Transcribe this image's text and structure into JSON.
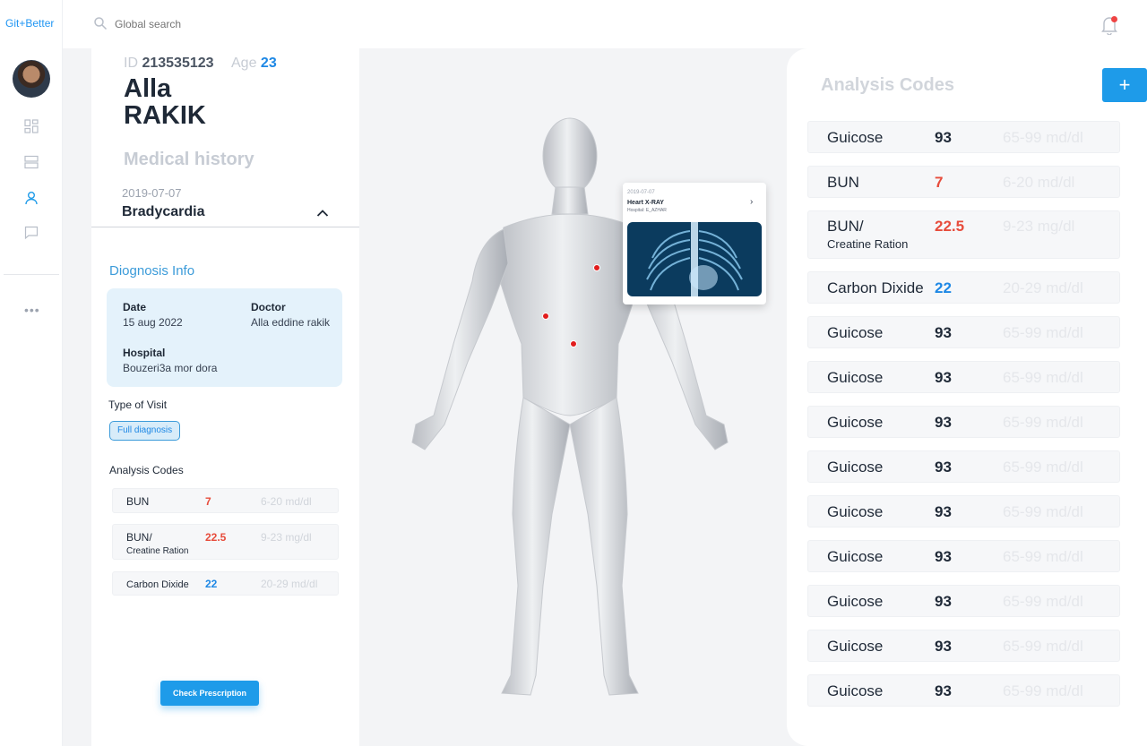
{
  "app": {
    "logo": "Git+Better"
  },
  "search": {
    "placeholder": "Global search"
  },
  "patient": {
    "id_label": "ID",
    "id": "213535123",
    "age_label": "Age",
    "age": "23",
    "first_name": "Alla",
    "last_name": "RAKIK"
  },
  "history": {
    "title": "Medical history",
    "date": "2019-07-07",
    "condition": "Bradycardia"
  },
  "diagnosis": {
    "title": "Diognosis Info",
    "date_label": "Date",
    "date": "15 aug 2022",
    "doctor_label": "Doctor",
    "doctor": "Alla eddine rakik",
    "hospital_label": "Hospital",
    "hospital": "Bouzeri3a mor dora",
    "visit_label": "Type of Visit",
    "visit_type": "Full diagnosis",
    "codes_title": "Analysis Codes",
    "codes": [
      {
        "name": "BUN",
        "sub": "",
        "value": "7",
        "range": "6-20 md/dl",
        "color": "#e74c3c"
      },
      {
        "name": "BUN/",
        "sub": "Creatine Ration",
        "value": "22.5",
        "range": "9-23 mg/dl",
        "color": "#e74c3c"
      },
      {
        "name": "Carbon Dixide",
        "sub": "",
        "value": "22",
        "range": "20-29 md/dl",
        "color": "#1e88e5"
      }
    ],
    "prescription_button": "Check Prescription"
  },
  "xray": {
    "date": "2019-07-07",
    "title": "Heart X-RAY",
    "hospital": "Hospital: E_AZHAR",
    "arrow": "›"
  },
  "analysis": {
    "title": "Analysis Codes",
    "add_label": "+",
    "rows": [
      {
        "name": "Guicose",
        "sub": "",
        "value": "93",
        "range": "65-99 md/dl",
        "color": "#1f2937"
      },
      {
        "name": "BUN",
        "sub": "",
        "value": "7",
        "range": "6-20 md/dl",
        "color": "#e74c3c"
      },
      {
        "name": "BUN/",
        "sub": "Creatine Ration",
        "value": "22.5",
        "range": "9-23 mg/dl",
        "color": "#e74c3c"
      },
      {
        "name": "Carbon Dixide",
        "sub": "",
        "value": "22",
        "range": "20-29 md/dl",
        "color": "#1e88e5"
      },
      {
        "name": "Guicose",
        "sub": "",
        "value": "93",
        "range": "65-99 md/dl",
        "color": "#1f2937"
      },
      {
        "name": "Guicose",
        "sub": "",
        "value": "93",
        "range": "65-99 md/dl",
        "color": "#1f2937"
      },
      {
        "name": "Guicose",
        "sub": "",
        "value": "93",
        "range": "65-99 md/dl",
        "color": "#1f2937"
      },
      {
        "name": "Guicose",
        "sub": "",
        "value": "93",
        "range": "65-99 md/dl",
        "color": "#1f2937"
      },
      {
        "name": "Guicose",
        "sub": "",
        "value": "93",
        "range": "65-99 md/dl",
        "color": "#1f2937"
      },
      {
        "name": "Guicose",
        "sub": "",
        "value": "93",
        "range": "65-99 md/dl",
        "color": "#1f2937"
      },
      {
        "name": "Guicose",
        "sub": "",
        "value": "93",
        "range": "65-99 md/dl",
        "color": "#1f2937"
      },
      {
        "name": "Guicose",
        "sub": "",
        "value": "93",
        "range": "65-99 md/dl",
        "color": "#1f2937"
      },
      {
        "name": "Guicose",
        "sub": "",
        "value": "93",
        "range": "65-99 md/dl",
        "color": "#1f2937"
      }
    ]
  },
  "sidebar": {
    "icons": [
      "dashboard-icon",
      "list-icon",
      "user-icon",
      "chat-icon"
    ],
    "more": "•••"
  }
}
